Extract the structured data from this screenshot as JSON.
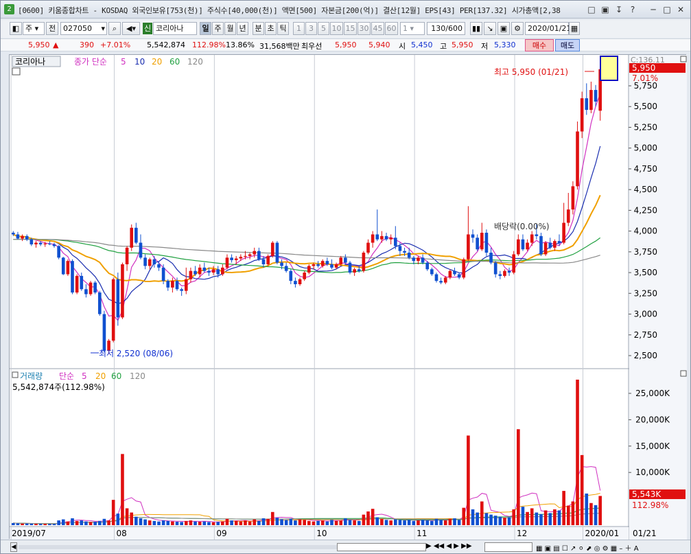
{
  "window": {
    "badge": "2",
    "title": "[0600] 키움종합차트 - KOSDAQ 외국인보유[753(천)] 주식수[40,000(천)] 액면[500] 자본금[200(억)] 결산[12월] EPS[43] PER[137.32] 시가총액[2,38",
    "buttons": [
      "□",
      "▣",
      "↧",
      "?",
      "─",
      "□",
      "✕"
    ]
  },
  "toolbar": {
    "period_unit": "주",
    "compare": "전",
    "code": "027050",
    "shin": "신",
    "stock_name": "코리아나",
    "periods": [
      "일",
      "주",
      "월",
      "년"
    ],
    "min_tick": [
      "분",
      "초",
      "틱"
    ],
    "intervals": [
      "1",
      "3",
      "5",
      "10",
      "15",
      "30",
      "45",
      "60"
    ],
    "n_value": "1",
    "count": "130/600",
    "date": "2020/01/21",
    "search_icon": "search-icon",
    "speaker_icon": "speaker-icon"
  },
  "quote": {
    "price": "5,950",
    "change_arrow": "▲",
    "change": "390",
    "change_pct": "+7.01%",
    "volume": "5,542,874",
    "vol_ratio": "112.98%",
    "turnover": "13.86%",
    "amount": "31,568백만",
    "best_bid_label": "최우선",
    "best_ask": "5,950",
    "best_bid": "5,940",
    "open_label": "시",
    "open": "5,450",
    "high_label": "고",
    "high": "5,950",
    "low_label": "저",
    "low": "5,330",
    "buy_label": "매수",
    "sell_label": "매도"
  },
  "price_panel": {
    "stock_tag": "코리아나",
    "ma_label": "종가 단순",
    "ma_periods": [
      "5",
      "10",
      "20",
      "60",
      "120"
    ],
    "ma_colors": [
      "#d030c0",
      "#1a2eb0",
      "#f0a000",
      "#20a040",
      "#888888"
    ],
    "high_note": "최고 5,950 (01/21)",
    "low_note": "최저 2,520 (08/06)",
    "event_note": "배당락(0.00%)",
    "cur_price_tag": "5,950",
    "cur_pct_tag": "7.01%",
    "clipped_value": "C:136.11",
    "y_ticks": [
      "5,750",
      "5,500",
      "5,250",
      "5,000",
      "4,750",
      "4,500",
      "4,250",
      "4,000",
      "3,750",
      "3,500",
      "3,250",
      "3,000",
      "2,750",
      "2,500"
    ]
  },
  "volume_panel": {
    "label": "거래량",
    "ma_label": "단순",
    "ma_periods": [
      "5",
      "20",
      "60",
      "120"
    ],
    "current": "5,542,874주(112.98%)",
    "cur_tag": "5,543K",
    "cur_pct_tag": "112.98%",
    "y_ticks": [
      "25,000K",
      "20,000K",
      "15,000K",
      "10,000K"
    ]
  },
  "x_axis": {
    "labels": [
      "2019/07",
      "08",
      "09",
      "10",
      "11",
      "12",
      "2020/01"
    ],
    "cursor_date": "01/21"
  },
  "colors": {
    "up": "#e01010",
    "down": "#1050d0"
  },
  "chart_data": {
    "type": "candlestick",
    "period": "daily",
    "range": [
      "2019/07",
      "2020/01/21"
    ],
    "ylim": [
      2400,
      6000
    ],
    "candles_ohlc": [
      [
        3980,
        4000,
        3940,
        3960
      ],
      [
        3960,
        3990,
        3900,
        3910
      ],
      [
        3910,
        3960,
        3880,
        3940
      ],
      [
        3940,
        3960,
        3880,
        3900
      ],
      [
        3900,
        3920,
        3820,
        3840
      ],
      [
        3840,
        3880,
        3800,
        3860
      ],
      [
        3860,
        3880,
        3820,
        3840
      ],
      [
        3840,
        3870,
        3810,
        3850
      ],
      [
        3850,
        3880,
        3830,
        3840
      ],
      [
        3840,
        3860,
        3800,
        3820
      ],
      [
        3820,
        3830,
        3660,
        3680
      ],
      [
        3680,
        3690,
        3470,
        3480
      ],
      [
        3480,
        3660,
        3460,
        3640
      ],
      [
        3640,
        3660,
        3240,
        3260
      ],
      [
        3260,
        3480,
        3240,
        3460
      ],
      [
        3460,
        3500,
        3280,
        3300
      ],
      [
        3300,
        3360,
        3200,
        3240
      ],
      [
        3240,
        3400,
        3220,
        3380
      ],
      [
        3380,
        3400,
        3240,
        3260
      ],
      [
        3260,
        3280,
        2980,
        3000
      ],
      [
        3000,
        3040,
        2540,
        2560
      ],
      [
        2560,
        2700,
        2520,
        2680
      ],
      [
        2680,
        3440,
        2660,
        3420
      ],
      [
        3420,
        3500,
        2860,
        2960
      ],
      [
        2960,
        3620,
        2940,
        3600
      ],
      [
        3600,
        3820,
        3520,
        3800
      ],
      [
        3800,
        4080,
        3760,
        4040
      ],
      [
        4040,
        4100,
        3840,
        3860
      ],
      [
        3860,
        3960,
        3660,
        3680
      ],
      [
        3680,
        3720,
        3540,
        3580
      ],
      [
        3580,
        3680,
        3540,
        3660
      ],
      [
        3660,
        3700,
        3560,
        3600
      ],
      [
        3600,
        3640,
        3520,
        3560
      ],
      [
        3560,
        3600,
        3360,
        3400
      ],
      [
        3400,
        3420,
        3280,
        3320
      ],
      [
        3320,
        3440,
        3260,
        3400
      ],
      [
        3400,
        3440,
        3280,
        3300
      ],
      [
        3300,
        3320,
        3220,
        3280
      ],
      [
        3280,
        3560,
        3240,
        3420
      ],
      [
        3420,
        3560,
        3380,
        3520
      ],
      [
        3520,
        3580,
        3460,
        3480
      ],
      [
        3480,
        3600,
        3440,
        3560
      ],
      [
        3560,
        3620,
        3500,
        3520
      ],
      [
        3520,
        3560,
        3460,
        3500
      ],
      [
        3500,
        3580,
        3470,
        3540
      ],
      [
        3540,
        3580,
        3440,
        3480
      ],
      [
        3480,
        3600,
        3460,
        3560
      ],
      [
        3560,
        3720,
        3540,
        3680
      ],
      [
        3680,
        3720,
        3620,
        3650
      ],
      [
        3650,
        3700,
        3600,
        3670
      ],
      [
        3670,
        3720,
        3640,
        3690
      ],
      [
        3690,
        3760,
        3660,
        3700
      ],
      [
        3700,
        3740,
        3660,
        3720
      ],
      [
        3720,
        3800,
        3680,
        3760
      ],
      [
        3760,
        3800,
        3640,
        3660
      ],
      [
        3660,
        3700,
        3560,
        3600
      ],
      [
        3600,
        3720,
        3580,
        3700
      ],
      [
        3700,
        3880,
        3680,
        3860
      ],
      [
        3860,
        3880,
        3600,
        3620
      ],
      [
        3620,
        3660,
        3540,
        3580
      ],
      [
        3580,
        3620,
        3500,
        3520
      ],
      [
        3520,
        3540,
        3360,
        3400
      ],
      [
        3400,
        3440,
        3320,
        3360
      ],
      [
        3360,
        3440,
        3340,
        3420
      ],
      [
        3420,
        3520,
        3400,
        3500
      ],
      [
        3500,
        3600,
        3480,
        3580
      ],
      [
        3580,
        3620,
        3540,
        3600
      ],
      [
        3600,
        3640,
        3560,
        3580
      ],
      [
        3580,
        3660,
        3560,
        3640
      ],
      [
        3640,
        3680,
        3580,
        3600
      ],
      [
        3600,
        3660,
        3540,
        3560
      ],
      [
        3560,
        3620,
        3540,
        3600
      ],
      [
        3600,
        3700,
        3580,
        3680
      ],
      [
        3680,
        3720,
        3600,
        3620
      ],
      [
        3620,
        3640,
        3480,
        3500
      ],
      [
        3500,
        3560,
        3460,
        3540
      ],
      [
        3540,
        3580,
        3500,
        3520
      ],
      [
        3520,
        3760,
        3500,
        3740
      ],
      [
        3740,
        3900,
        3720,
        3860
      ],
      [
        3860,
        4000,
        3800,
        3960
      ],
      [
        3960,
        4260,
        3880,
        3900
      ],
      [
        3900,
        4000,
        3860,
        3940
      ],
      [
        3940,
        3980,
        3880,
        3900
      ],
      [
        3900,
        3960,
        3840,
        3920
      ],
      [
        3920,
        4060,
        3780,
        3820
      ],
      [
        3820,
        3860,
        3700,
        3760
      ],
      [
        3760,
        3800,
        3700,
        3740
      ],
      [
        3740,
        3800,
        3660,
        3680
      ],
      [
        3680,
        3700,
        3600,
        3640
      ],
      [
        3640,
        3700,
        3600,
        3680
      ],
      [
        3680,
        3720,
        3600,
        3620
      ],
      [
        3620,
        3640,
        3520,
        3540
      ],
      [
        3540,
        3560,
        3460,
        3480
      ],
      [
        3480,
        3500,
        3380,
        3400
      ],
      [
        3400,
        3440,
        3360,
        3380
      ],
      [
        3380,
        3460,
        3360,
        3440
      ],
      [
        3440,
        3540,
        3420,
        3520
      ],
      [
        3520,
        3560,
        3460,
        3480
      ],
      [
        3480,
        3500,
        3420,
        3440
      ],
      [
        3440,
        3680,
        3420,
        3660
      ],
      [
        3660,
        4300,
        3640,
        3960
      ],
      [
        3960,
        4020,
        3860,
        3920
      ],
      [
        3920,
        3960,
        3760,
        3780
      ],
      [
        3780,
        4100,
        3760,
        3980
      ],
      [
        3980,
        4020,
        3700,
        3740
      ],
      [
        3740,
        3800,
        3600,
        3620
      ],
      [
        3620,
        3640,
        3440,
        3480
      ],
      [
        3480,
        3520,
        3420,
        3460
      ],
      [
        3460,
        3540,
        3440,
        3520
      ],
      [
        3520,
        3560,
        3460,
        3500
      ],
      [
        3500,
        3760,
        3480,
        3720
      ],
      [
        3720,
        3960,
        3700,
        3900
      ],
      [
        3900,
        3960,
        3760,
        3780
      ],
      [
        3780,
        3900,
        3760,
        3860
      ],
      [
        3860,
        4000,
        3820,
        3960
      ],
      [
        3960,
        4080,
        3900,
        3940
      ],
      [
        3940,
        3980,
        3700,
        3720
      ],
      [
        3720,
        3880,
        3700,
        3860
      ],
      [
        3860,
        3920,
        3780,
        3800
      ],
      [
        3800,
        3900,
        3760,
        3880
      ],
      [
        3880,
        3960,
        3820,
        3860
      ],
      [
        3860,
        4340,
        3840,
        4100
      ],
      [
        4100,
        4460,
        4060,
        4260
      ],
      [
        4260,
        4600,
        4200,
        4540
      ],
      [
        4540,
        5320,
        4500,
        5200
      ],
      [
        5200,
        5680,
        5120,
        5600
      ],
      [
        5600,
        5780,
        5400,
        5460
      ],
      [
        5460,
        5800,
        5420,
        5700
      ],
      [
        5700,
        5760,
        5500,
        5560
      ],
      [
        5450,
        5950,
        5330,
        5950
      ]
    ],
    "volume_k": [
      400,
      350,
      300,
      320,
      280,
      260,
      240,
      250,
      230,
      220,
      900,
      1100,
      700,
      1300,
      800,
      900,
      700,
      600,
      650,
      800,
      1200,
      900,
      4800,
      2200,
      13500,
      3200,
      2400,
      1600,
      1300,
      1100,
      900,
      800,
      700,
      900,
      800,
      700,
      650,
      600,
      800,
      900,
      700,
      650,
      700,
      600,
      550,
      600,
      700,
      1200,
      900,
      800,
      700,
      900,
      700,
      1100,
      800,
      1300,
      1200,
      2500,
      1400,
      1100,
      1000,
      1200,
      900,
      1100,
      1000,
      800,
      700,
      800,
      900,
      700,
      1000,
      800,
      900,
      1300,
      1000,
      900,
      800,
      2000,
      2600,
      3100,
      1500,
      1200,
      1000,
      900,
      1100,
      1000,
      900,
      1000,
      800,
      900,
      1000,
      900,
      800,
      1200,
      1000,
      900,
      1200,
      1300,
      1000,
      3300,
      17000,
      3000,
      2400,
      4500,
      2300,
      2000,
      1800,
      1600,
      1400,
      1500,
      3000,
      18200,
      3500,
      2500,
      3200,
      2400,
      2100,
      2800,
      2300,
      3000,
      2800,
      6500,
      3700,
      4500,
      27600,
      13300,
      6000,
      4200,
      3800,
      5543
    ]
  }
}
